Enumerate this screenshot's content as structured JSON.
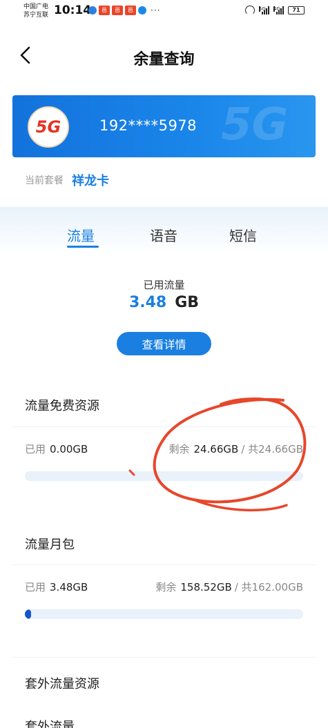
{
  "status_bar": {
    "carrier_line1": "中国广电",
    "carrier_line2": "苏宁互联",
    "time": "10:14",
    "notif_badge": "邑",
    "network_a": "5G",
    "network_b": "4G",
    "battery": "71",
    "more": "···"
  },
  "header": {
    "title": "余量查询",
    "back_icon": "chevron-left-icon"
  },
  "card": {
    "logo_text": "5G",
    "phone_number": "192****5978",
    "watermark": "5G",
    "color": "#1a7fe0"
  },
  "plan": {
    "label": "当前套餐",
    "value": "祥龙卡"
  },
  "tabs": [
    {
      "label": "流量",
      "active": true
    },
    {
      "label": "语音",
      "active": false
    },
    {
      "label": "短信",
      "active": false
    }
  ],
  "summary": {
    "label": "已用流量",
    "value": "3.48",
    "unit": "GB",
    "detail_button": "查看详情"
  },
  "sections": [
    {
      "title": "流量免费资源",
      "used_label": "已用",
      "used_value": "0.00GB",
      "remain_label": "剩余",
      "remain_value": "24.66GB",
      "total_text": "/ 共24.66GB",
      "used_fraction": 0.0
    },
    {
      "title": "流量月包",
      "used_label": "已用",
      "used_value": "3.48GB",
      "remain_label": "剩余",
      "remain_value": "158.52GB",
      "total_text": "/ 共162.00GB",
      "used_fraction": 0.0215
    },
    {
      "title": "套外流量资源"
    },
    {
      "title": "套外流量"
    }
  ],
  "colors": {
    "accent": "#1a7fe0",
    "bar_fill": "#1556c9",
    "bar_track": "#e9f1fa",
    "annotation": "#e8462b"
  }
}
